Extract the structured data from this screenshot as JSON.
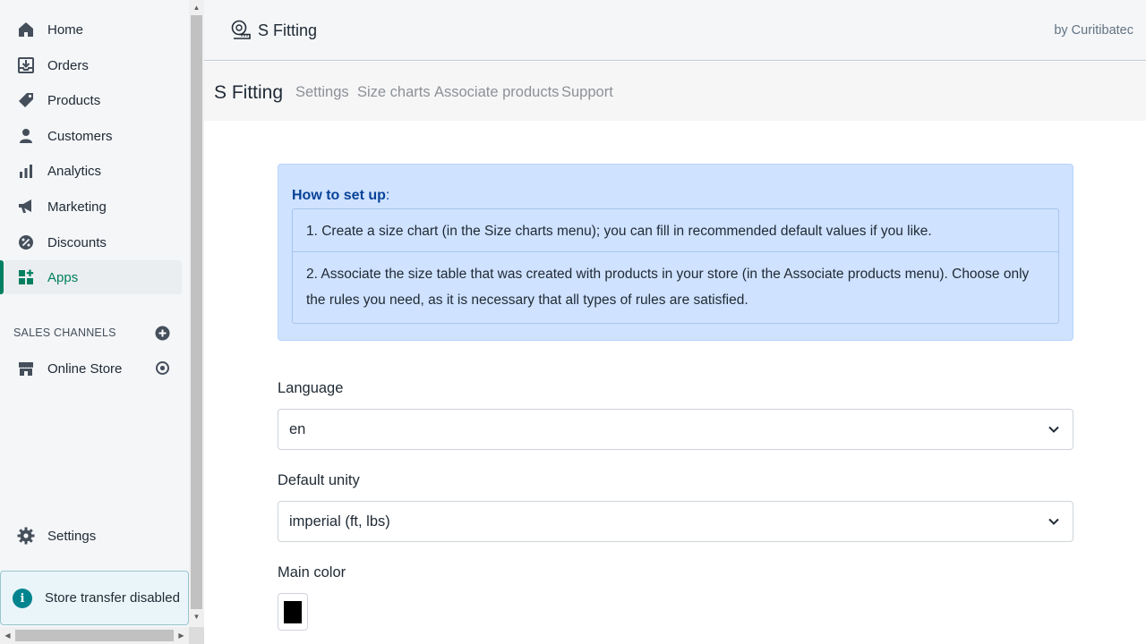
{
  "sidebar": {
    "items": [
      {
        "label": "Home",
        "icon": "home-icon"
      },
      {
        "label": "Orders",
        "icon": "orders-icon"
      },
      {
        "label": "Products",
        "icon": "tag-icon"
      },
      {
        "label": "Customers",
        "icon": "person-icon"
      },
      {
        "label": "Analytics",
        "icon": "bar-chart-icon"
      },
      {
        "label": "Marketing",
        "icon": "megaphone-icon"
      },
      {
        "label": "Discounts",
        "icon": "discount-icon"
      },
      {
        "label": "Apps",
        "icon": "apps-icon",
        "active": true
      }
    ],
    "sales_channels_title": "SALES CHANNELS",
    "channels": [
      {
        "label": "Online Store",
        "icon": "store-icon"
      }
    ],
    "settings_label": "Settings",
    "transfer_notice": "Store transfer disabled"
  },
  "app_header": {
    "title": "S Fitting",
    "by": "by Curitibatec"
  },
  "tabs": {
    "brand": "S Fitting",
    "items": [
      "Settings",
      "Size charts",
      "Associate products",
      "Support"
    ]
  },
  "setup": {
    "title": "How to set up",
    "colon": ":",
    "steps": [
      "1. Create a size chart (in the Size charts menu); you can fill in recommended default values if you like.",
      "2. Associate the size table that was created with products in your store (in the Associate products menu). Choose only the rules you need, as it is necessary that all types of rules are satisfied."
    ]
  },
  "form": {
    "language_label": "Language",
    "language_value": "en",
    "unity_label": "Default unity",
    "unity_value": "imperial (ft, lbs)",
    "color_label": "Main color",
    "color_value": "#000000"
  },
  "colors": {
    "accent": "#008060",
    "alert_bg": "#cfe2ff",
    "alert_title": "#084298"
  }
}
